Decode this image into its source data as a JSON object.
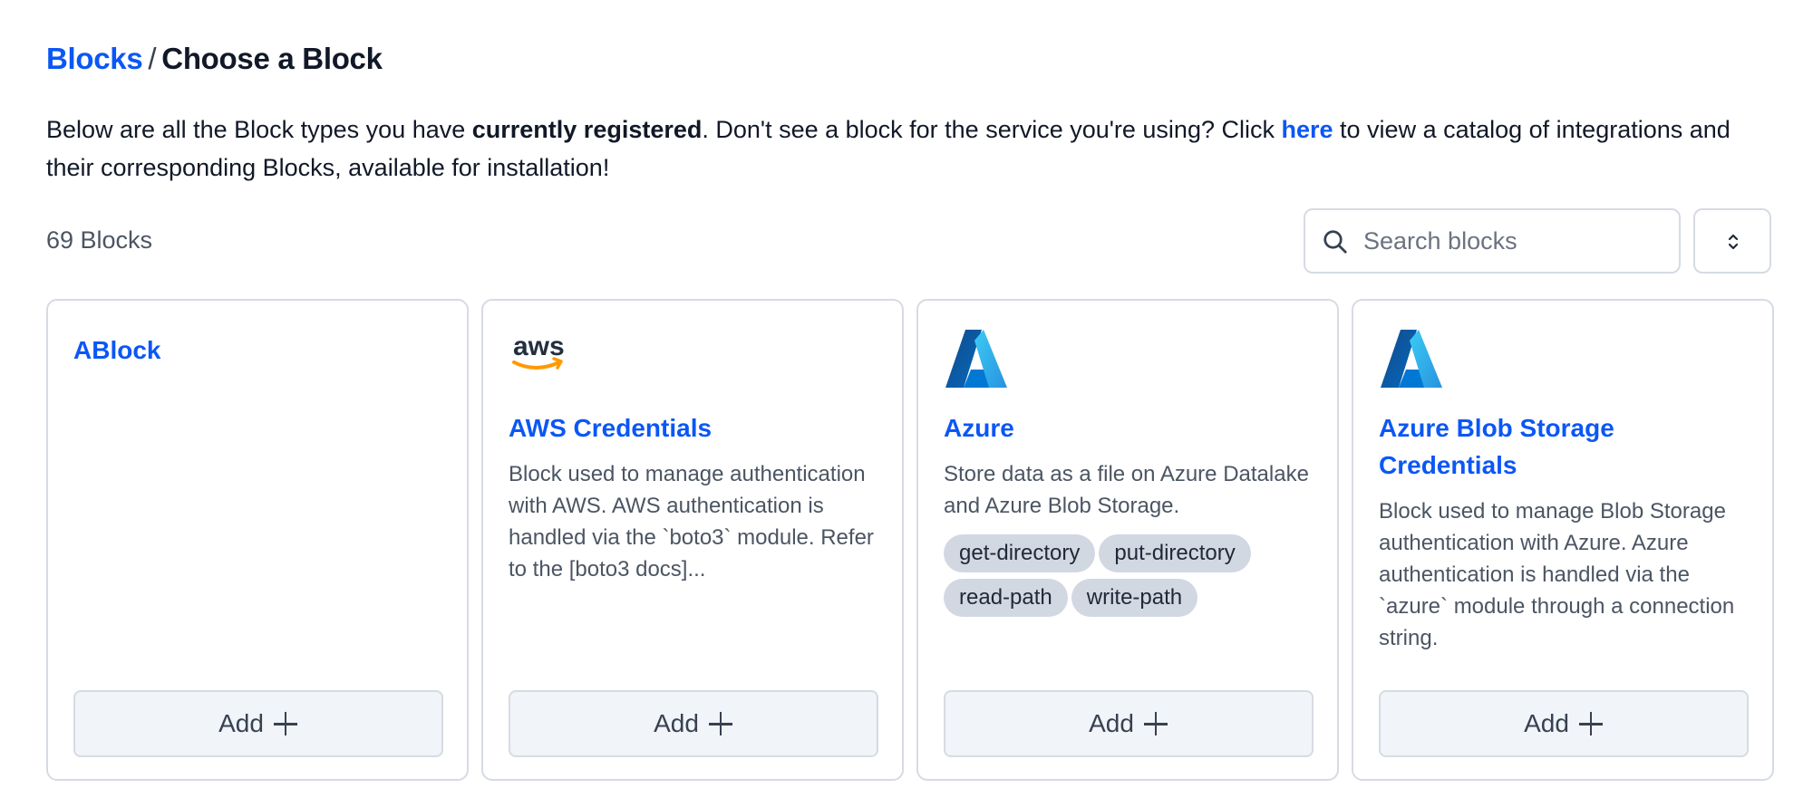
{
  "breadcrumb": {
    "root": "Blocks",
    "separator": "/",
    "current": "Choose a Block"
  },
  "intro": {
    "part1": "Below are all the Block types you have ",
    "bold": "currently registered",
    "part2": ". Don't see a block for the service you're using? Click ",
    "link": "here",
    "part3": " to view a catalog of integrations and their corresponding Blocks, available for installation!"
  },
  "toolbar": {
    "count_label": "69 Blocks",
    "search_placeholder": "Search blocks",
    "search_icon": "search-icon",
    "sort_icon": "chevron-up-down-icon"
  },
  "colors": {
    "link": "#0b57f5",
    "tag_bg": "#d1d8e2",
    "card_border": "#d6dbe3",
    "button_bg": "#f1f4f8"
  },
  "cards": [
    {
      "title": "ABlock",
      "logo": "",
      "description": "",
      "tags": [],
      "button_label": "Add"
    },
    {
      "title": "AWS Credentials",
      "logo": "aws-logo",
      "logo_text": "aws",
      "description": "Block used to manage authentication with AWS. AWS authentication is handled via the `boto3` module. Refer to the [boto3 docs]...",
      "tags": [],
      "button_label": "Add"
    },
    {
      "title": "Azure",
      "logo": "azure-logo",
      "description": "Store data as a file on Azure Datalake and Azure Blob Storage.",
      "tags": [
        "get-directory",
        "put-directory",
        "read-path",
        "write-path"
      ],
      "button_label": "Add"
    },
    {
      "title": "Azure Blob Storage Credentials",
      "logo": "azure-logo",
      "description": "Block used to manage Blob Storage authentication with Azure. Azure authentication is handled via the `azure` module through a connection string.",
      "tags": [],
      "button_label": "Add"
    }
  ]
}
